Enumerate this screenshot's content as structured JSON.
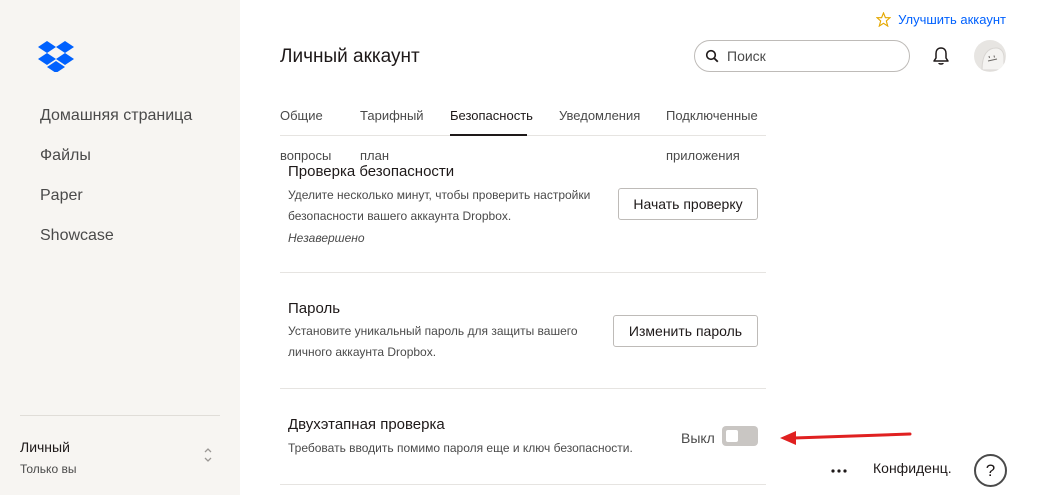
{
  "sidebar": {
    "logo_icon": "dropbox-logo",
    "brand_color": "#0061fe",
    "items": [
      {
        "label": "Домашняя страница"
      },
      {
        "label": "Файлы"
      },
      {
        "label": "Paper"
      },
      {
        "label": "Showcase"
      }
    ],
    "account": {
      "name": "Личный",
      "subtitle": "Только вы"
    }
  },
  "header": {
    "upgrade_label": "Улучшить аккаунт",
    "title": "Личный аккаунт",
    "search_placeholder": "Поиск"
  },
  "tabs": [
    {
      "line1": "Общие",
      "line2": "вопросы"
    },
    {
      "line1": "Тарифный",
      "line2": "план"
    },
    {
      "line1": "Безопасность",
      "line2": "",
      "active": true
    },
    {
      "line1": "Уведомления",
      "line2": ""
    },
    {
      "line1": "Подключенные",
      "line2": "приложения"
    }
  ],
  "sections": {
    "security_check": {
      "title": "Проверка безопасности",
      "desc_line1": "Уделите несколько минут, чтобы проверить настройки",
      "desc_line2": "безопасности вашего аккаунта Dropbox.",
      "status": "Незавершено",
      "button": "Начать проверку"
    },
    "password": {
      "title": "Пароль",
      "desc_line1": "Установите уникальный пароль для защиты вашего",
      "desc_line2": "личного аккаунта Dropbox.",
      "button": "Изменить пароль"
    },
    "two_step": {
      "title": "Двухэтапная проверка",
      "desc": "Требовать вводить помимо пароля еще и ключ безопасности.",
      "toggle_label": "Выкл",
      "toggle_on": false
    }
  },
  "footer": {
    "more_label": "...",
    "privacy_label": "Конфиденц.",
    "help_label": "?"
  },
  "annotation": {
    "arrow_color": "#e02020"
  }
}
